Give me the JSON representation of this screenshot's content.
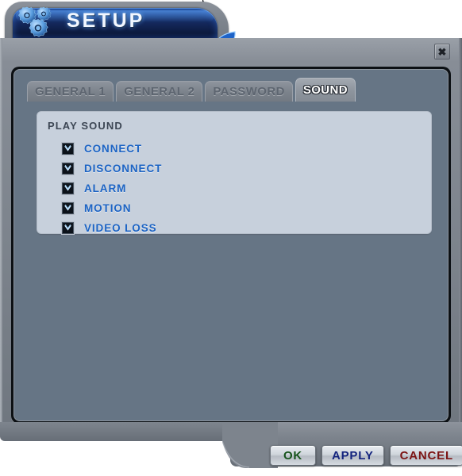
{
  "window": {
    "title": "SETUP",
    "logo_icon": "gears-icon",
    "close_icon": "close-x-icon",
    "close_label": "✖"
  },
  "tabs": [
    {
      "label": "GENERAL 1",
      "active": false
    },
    {
      "label": "GENERAL 2",
      "active": false
    },
    {
      "label": "PASSWORD",
      "active": false
    },
    {
      "label": "SOUND",
      "active": true
    }
  ],
  "sound_panel": {
    "group_title": "PLAY SOUND",
    "options": [
      {
        "label": "CONNECT",
        "checked": true,
        "icon": "checkbox-checked-icon"
      },
      {
        "label": "DISCONNECT",
        "checked": true,
        "icon": "checkbox-checked-icon"
      },
      {
        "label": "ALARM",
        "checked": true,
        "icon": "checkbox-checked-icon"
      },
      {
        "label": "MOTION",
        "checked": true,
        "icon": "checkbox-checked-icon"
      },
      {
        "label": "VIDEO LOSS",
        "checked": true,
        "icon": "checkbox-checked-icon"
      }
    ]
  },
  "footer": {
    "ok_label": "OK",
    "apply_label": "APPLY",
    "cancel_label": "CANCEL"
  },
  "colors": {
    "header_blue": "#14285c",
    "window_gray": "#7d848d",
    "content_slate": "#667585",
    "group_panel": "#c7d0dc",
    "label_blue": "#1b63c4",
    "ok_green": "#17541c",
    "apply_blue": "#14247e",
    "cancel_red": "#7c1414"
  }
}
